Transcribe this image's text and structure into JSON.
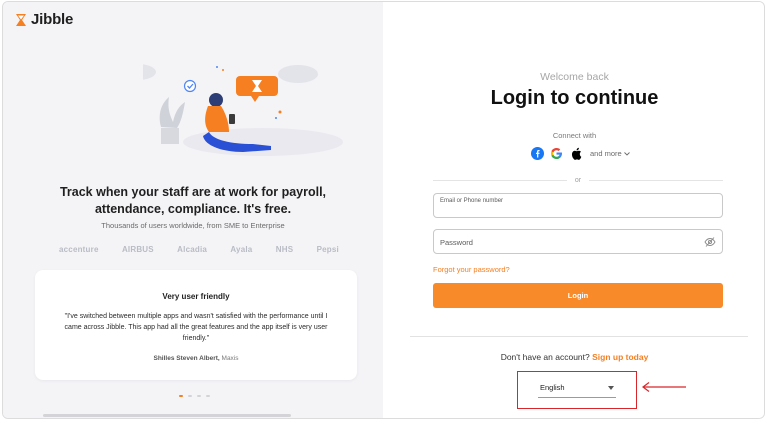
{
  "brand": {
    "name": "Jibble",
    "accent": "#f57f21"
  },
  "hero": {
    "tagline_line1": "Track when your staff are at work for payroll,",
    "tagline_line2": "attendance, compliance. It's free.",
    "users_line": "Thousands of users worldwide, from SME to Enterprise",
    "brands": [
      "accenture",
      "AIRBUS",
      "Alcadia",
      "Ayala",
      "NHS",
      "Pepsi"
    ]
  },
  "testimonial": {
    "title": "Very user friendly",
    "body": "\"I've switched between multiple apps and wasn't satisfied with the performance until I came across Jibble. This app had all the great features and the app itself is very user friendly.\"",
    "author": "Shilles Steven Albert,",
    "company": "Maxis",
    "active_dot_index": 0,
    "dot_count": 4
  },
  "login": {
    "welcome": "Welcome back",
    "title": "Login to continue",
    "connect_with": "Connect with",
    "social_icons": [
      "facebook-icon",
      "google-icon",
      "apple-icon"
    ],
    "and_more": "and more",
    "or": "or",
    "email_label": "Email or Phone number",
    "password_placeholder": "Password",
    "forgot": "Forgot your password?",
    "login_button": "Login",
    "no_account": "Don't have an account?",
    "signup_link": "Sign up today",
    "language": "English"
  }
}
